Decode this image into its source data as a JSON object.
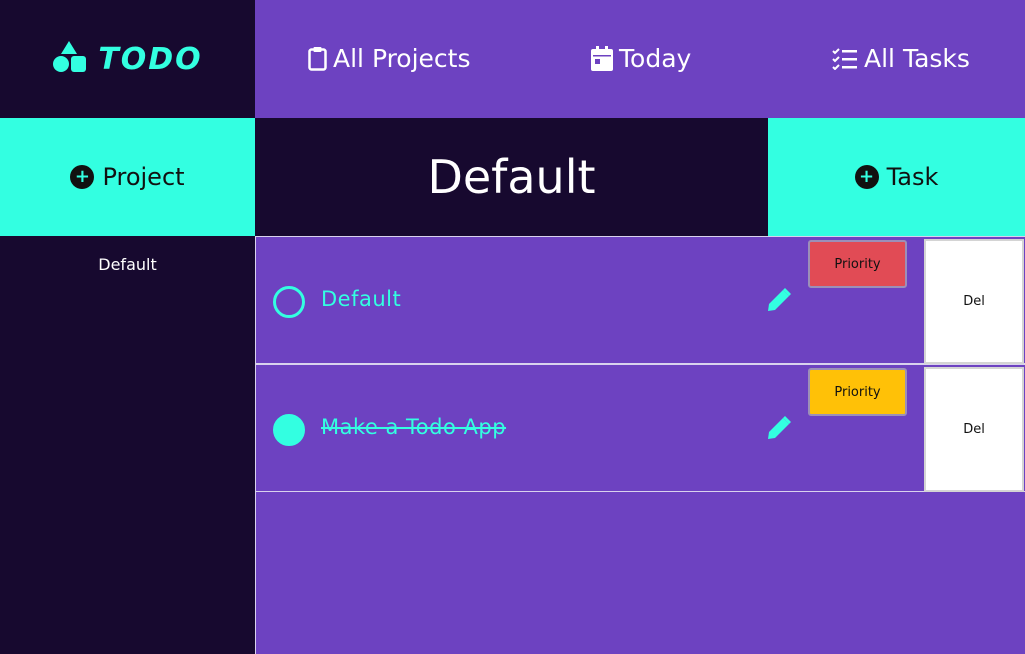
{
  "app": {
    "logo_text": "TODO",
    "accent_color": "#33ffe1",
    "dark_color": "#17092f",
    "purple_color": "#6d42c1"
  },
  "nav": {
    "all_projects": "All Projects",
    "today": "Today",
    "all_tasks": "All Tasks"
  },
  "sidebar": {
    "add_project_label": "Project",
    "projects": [
      {
        "label": "Default"
      }
    ]
  },
  "main": {
    "project_title": "Default",
    "add_task_label": "Task",
    "tasks": [
      {
        "name": "Default",
        "completed": false,
        "priority_label": "Priority",
        "priority_color": "#e14b55",
        "delete_label": "Del"
      },
      {
        "name": "Make a Todo App",
        "completed": true,
        "priority_label": "Priority",
        "priority_color": "#ffc107",
        "delete_label": "Del"
      }
    ]
  }
}
